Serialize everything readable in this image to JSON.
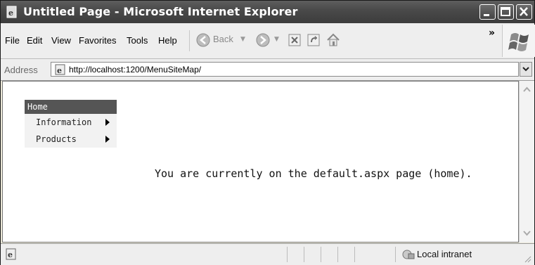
{
  "window": {
    "title": "Untitled Page - Microsoft Internet Explorer"
  },
  "menubar": {
    "items": [
      "File",
      "Edit",
      "View",
      "Favorites",
      "Tools",
      "Help"
    ],
    "back_label": "Back",
    "more_glyph": "»"
  },
  "address": {
    "label": "Address",
    "url": "http://localhost:1200/MenuSiteMap/"
  },
  "content": {
    "menu": {
      "home": "Home",
      "items": [
        {
          "label": "Information"
        },
        {
          "label": "Products"
        }
      ]
    },
    "message": "You are currently on the default.aspx page (home)."
  },
  "status": {
    "zone": "Local intranet"
  },
  "icons": [
    "ie-page-icon",
    "minimize-icon",
    "maximize-icon",
    "close-icon",
    "back-icon",
    "forward-icon",
    "stop-icon",
    "refresh-icon",
    "home-icon",
    "windows-logo-icon",
    "chevron-down-icon",
    "scroll-up-icon",
    "scroll-down-icon",
    "intranet-icon",
    "resize-grip-icon"
  ]
}
